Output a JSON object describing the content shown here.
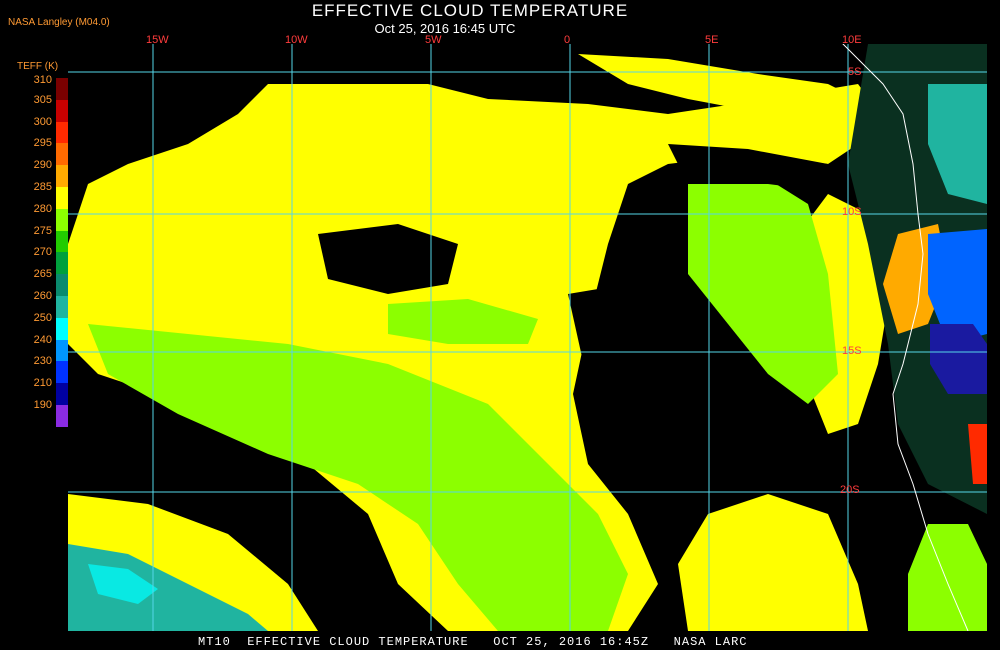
{
  "header": {
    "title": "EFFECTIVE CLOUD TEMPERATURE",
    "subtitle": "Oct 25, 2016 16:45 UTC",
    "source": "NASA Langley (M04.0)"
  },
  "legend": {
    "title": "TEFF (K)",
    "entries": [
      {
        "label": "310",
        "color": "#7a0000"
      },
      {
        "label": "305",
        "color": "#c80000"
      },
      {
        "label": "300",
        "color": "#ff2a00"
      },
      {
        "label": "295",
        "color": "#ff6a00"
      },
      {
        "label": "290",
        "color": "#ffaa00"
      },
      {
        "label": "285",
        "color": "#ffff00"
      },
      {
        "label": "280",
        "color": "#8cff00"
      },
      {
        "label": "275",
        "color": "#22cc00"
      },
      {
        "label": "270",
        "color": "#00a03c"
      },
      {
        "label": "265",
        "color": "#0a8a6e"
      },
      {
        "label": "260",
        "color": "#20b4a0"
      },
      {
        "label": "250",
        "color": "#00ffff"
      },
      {
        "label": "240",
        "color": "#0096ff"
      },
      {
        "label": "230",
        "color": "#0032ff"
      },
      {
        "label": "210",
        "color": "#0000a0"
      },
      {
        "label": "190",
        "color": "#8a2be2"
      }
    ]
  },
  "grid": {
    "color": "#55d6e8",
    "longitudes": [
      "15W",
      "10W",
      "5W",
      "0",
      "5E",
      "10E"
    ],
    "latitudes": [
      "5S",
      "10S",
      "15S",
      "20S"
    ]
  },
  "footer": {
    "text": "MT10  EFFECTIVE CLOUD TEMPERATURE   OCT 25, 2016 16:45Z   NASA LARC"
  },
  "colors": {
    "background": "#000000",
    "label_orange": "#ff9a33",
    "grid_label_red": "#ff3c3c",
    "coastline": "#ffffff"
  }
}
